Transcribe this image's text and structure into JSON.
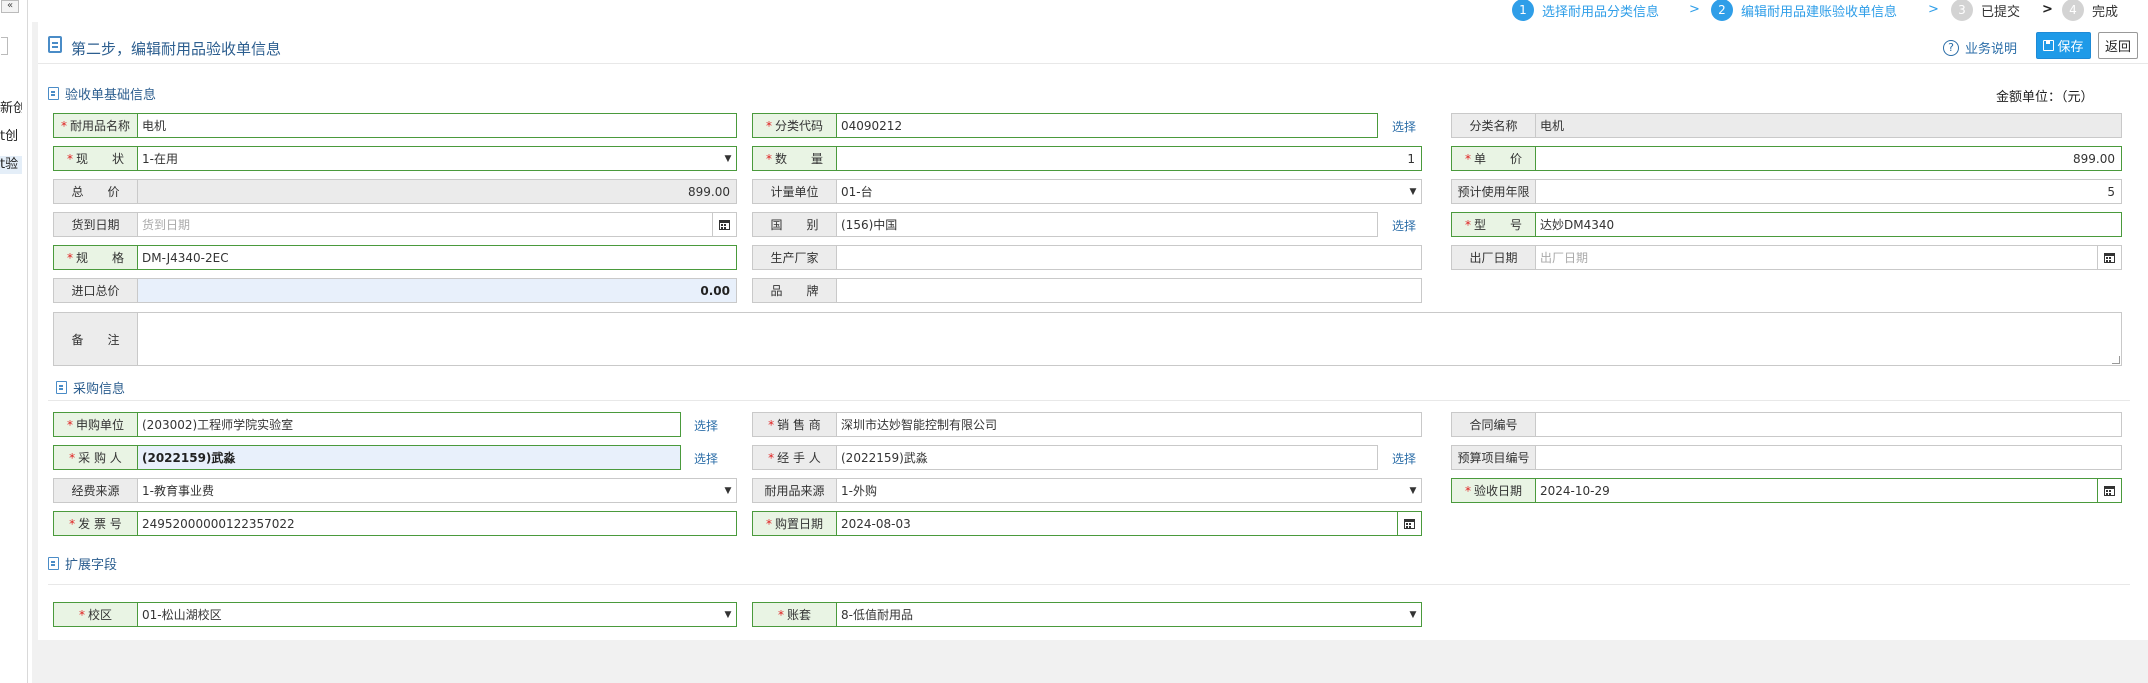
{
  "left_nav": {
    "collapse_symbol": "«",
    "items": [
      {
        "label": "新创"
      },
      {
        "label": "t创"
      },
      {
        "label": "t验"
      }
    ]
  },
  "steps": [
    {
      "num": "1",
      "label": "选择耐用品分类信息",
      "state": "done"
    },
    {
      "num": "2",
      "label": "编辑耐用品建账验收单信息",
      "state": "current"
    },
    {
      "num": "3",
      "label": "已提交",
      "state": "pending"
    },
    {
      "num": "4",
      "label": "完成",
      "state": "pending"
    }
  ],
  "step_separator": ">",
  "header": {
    "title": "第二步，编辑耐用品验收单信息",
    "help_label": "业务说明",
    "save_label": "保存",
    "back_label": "返回"
  },
  "sections": {
    "basic": "验收单基础信息",
    "purchase": "采购信息",
    "extend": "扩展字段"
  },
  "currency_unit": "金额单位：（元）",
  "select_link": "选择",
  "basic": {
    "name": {
      "label": "耐用品名称",
      "value": "电机"
    },
    "category_code": {
      "label": "分类代码",
      "value": "04090212"
    },
    "category_name": {
      "label": "分类名称",
      "value": "电机"
    },
    "status": {
      "label": "现　　状",
      "value": "1-在用"
    },
    "quantity": {
      "label": "数　　量",
      "value": "1"
    },
    "unit_price": {
      "label": "单　　价",
      "value": "899.00"
    },
    "total_price": {
      "label": "总　　价",
      "value": "899.00"
    },
    "measure_unit": {
      "label": "计量单位",
      "value": "01-台"
    },
    "expected_years": {
      "label": "预计使用年限",
      "value": "5"
    },
    "arrival_date": {
      "label": "货到日期",
      "placeholder": "货到日期"
    },
    "country": {
      "label": "国　　别",
      "value": "(156)中国"
    },
    "model": {
      "label": "型　　号",
      "value": "达妙DM4340"
    },
    "spec": {
      "label": "规　　格",
      "value": "DM-J4340-2EC"
    },
    "manufacturer": {
      "label": "生产厂家",
      "value": ""
    },
    "factory_date": {
      "label": "出厂日期",
      "placeholder": "出厂日期"
    },
    "import_total": {
      "label": "进口总价",
      "value": "0.00"
    },
    "brand": {
      "label": "品　　牌",
      "value": ""
    },
    "remark": {
      "label": "备　　注",
      "value": ""
    }
  },
  "purchase": {
    "applicant_unit": {
      "label": "申购单位",
      "value": "(203002)工程师学院实验室"
    },
    "vendor": {
      "label": "销 售 商",
      "value": "深圳市达妙智能控制有限公司"
    },
    "contract_no": {
      "label": "合同编号",
      "value": ""
    },
    "purchaser": {
      "label": "采 购 人",
      "value": "(2022159)武淼"
    },
    "handler": {
      "label": "经 手 人",
      "value": "(2022159)武淼"
    },
    "budget_no": {
      "label": "预算项目编号",
      "value": ""
    },
    "fund_source": {
      "label": "经费来源",
      "value": "1-教育事业费"
    },
    "item_source": {
      "label": "耐用品来源",
      "value": "1-外购"
    },
    "acceptance_date": {
      "label": "验收日期",
      "value": "2024-10-29"
    },
    "invoice_no": {
      "label": "发 票 号",
      "value": "24952000000122357022"
    },
    "purchase_date": {
      "label": "购置日期",
      "value": "2024-08-03"
    }
  },
  "extend": {
    "campus": {
      "label": "校区",
      "value": "01-松山湖校区"
    },
    "ledger": {
      "label": "账套",
      "value": "8-低值耐用品"
    }
  },
  "colors": {
    "accent": "#1e9ae8",
    "required_border": "#4a9a3c",
    "required_label_bg": "#e9f4e4",
    "required_star": "#e02020",
    "section_title": "#2c5e8f"
  }
}
